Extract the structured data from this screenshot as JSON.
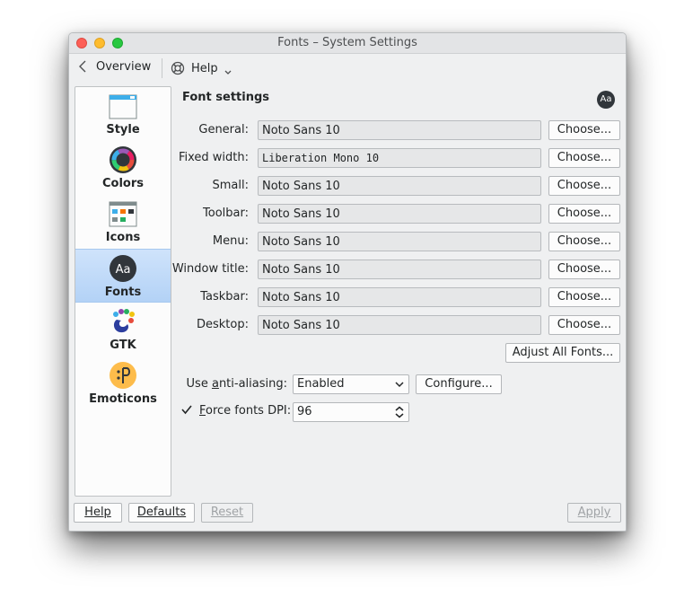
{
  "window": {
    "title": "Fonts – System Settings"
  },
  "toolbar": {
    "overview_label": "Overview",
    "help_label": "Help"
  },
  "sidebar": {
    "items": [
      {
        "label": "Style",
        "icon": "style-icon"
      },
      {
        "label": "Colors",
        "icon": "colors-icon"
      },
      {
        "label": "Icons",
        "icon": "icons-icon"
      },
      {
        "label": "Fonts",
        "icon": "fonts-icon",
        "selected": true
      },
      {
        "label": "GTK",
        "icon": "gtk-icon"
      },
      {
        "label": "Emoticons",
        "icon": "emoticons-icon"
      }
    ]
  },
  "panel": {
    "title": "Font settings",
    "badge": "Aa",
    "fonts": [
      {
        "label": "General:",
        "value": "Noto Sans 10"
      },
      {
        "label": "Fixed width:",
        "value": "Liberation Mono 10"
      },
      {
        "label": "Small:",
        "value": "Noto Sans 10"
      },
      {
        "label": "Toolbar:",
        "value": "Noto Sans 10"
      },
      {
        "label": "Menu:",
        "value": "Noto Sans 10"
      },
      {
        "label": "Window title:",
        "value": "Noto Sans 10"
      },
      {
        "label": "Taskbar:",
        "value": "Noto Sans 10"
      },
      {
        "label": "Desktop:",
        "value": "Noto Sans 10"
      }
    ],
    "choose_label": "Choose...",
    "adjust_all_label": "Adjust All Fonts...",
    "antialias_label_pre": "Use ",
    "antialias_label_ul": "a",
    "antialias_label_post": "nti-aliasing:",
    "antialias_value": "Enabled",
    "configure_label": "Configure...",
    "dpi_label_ul": "F",
    "dpi_label_post": "orce fonts DPI:",
    "dpi_checked": true,
    "dpi_value": "96"
  },
  "footer": {
    "help_label": "Help",
    "defaults_label": "Defaults",
    "reset_label": "Reset",
    "apply_label": "Apply"
  },
  "colors": {
    "selection": "#b3d2f6",
    "close": "#fd5f57",
    "minimize": "#febc2e",
    "maximize": "#28c840"
  }
}
